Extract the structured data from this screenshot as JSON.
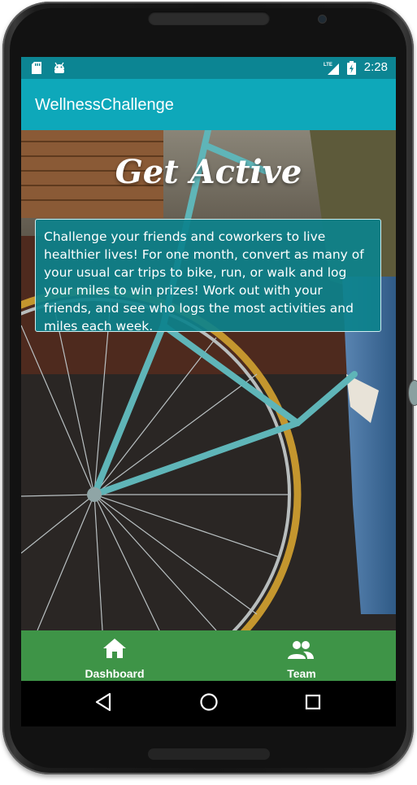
{
  "device": {
    "status_bar": {
      "time": "2:28",
      "icons": [
        "sd-card-icon",
        "android-icon",
        "lte-signal-icon",
        "battery-charging-icon"
      ]
    },
    "system_nav": [
      "back-icon",
      "home-icon",
      "recents-icon"
    ]
  },
  "app": {
    "title": "WellnessChallenge",
    "hero": {
      "heading": "Get Active",
      "description": "Challenge your friends and coworkers to live healthier lives! For one month, convert as many of your usual car trips to bike, run, or walk and log your miles to win prizes! Work out with your friends, and see who logs the most activities and miles each week.",
      "background_image": "bicycle with basket and person in ripped jeans"
    },
    "bottom_nav": {
      "items": [
        {
          "label": "Dashboard",
          "icon": "home-icon"
        },
        {
          "label": "Team",
          "icon": "group-icon"
        }
      ]
    }
  },
  "colors": {
    "status_bar": "#0c8593",
    "app_bar": "#0ea8ba",
    "description_box": "#0c828c",
    "bottom_nav": "#3e9447"
  }
}
